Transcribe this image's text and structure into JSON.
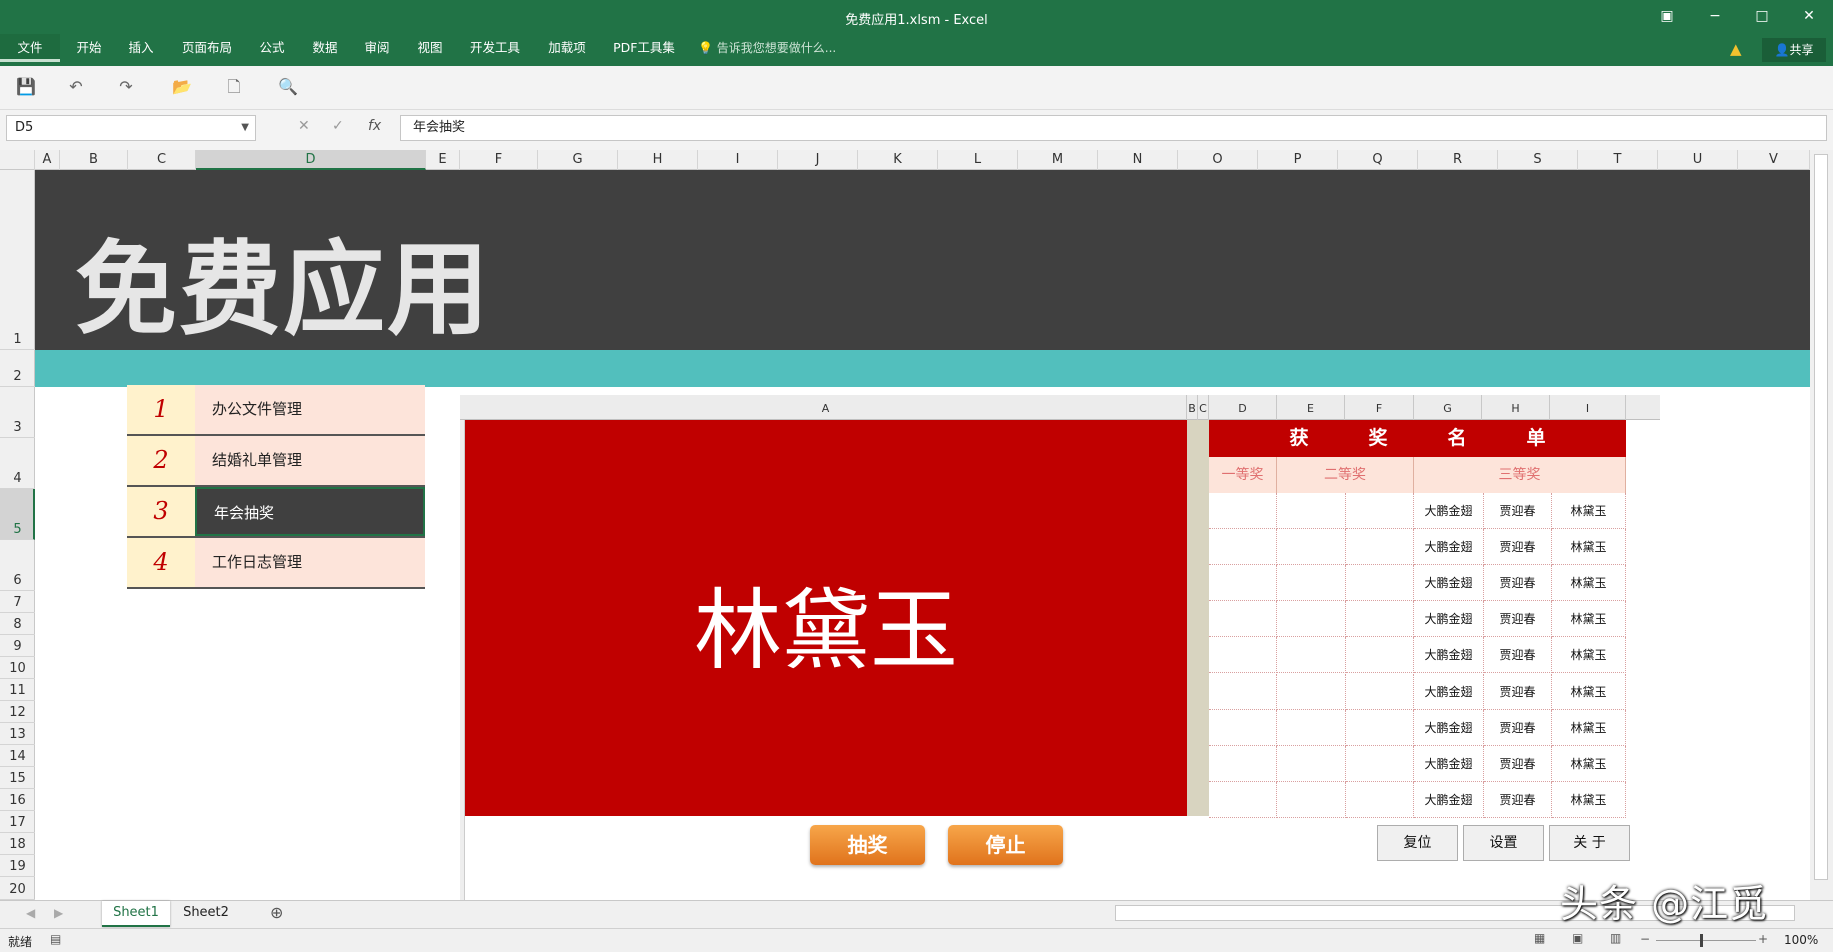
{
  "window": {
    "title": "免费应用1.xlsm - Excel",
    "share": "共享"
  },
  "menu": {
    "items": [
      "文件",
      "开始",
      "插入",
      "页面布局",
      "公式",
      "数据",
      "审阅",
      "视图",
      "开发工具",
      "加载项",
      "PDF工具集"
    ],
    "tellme": "告诉我您想要做什么..."
  },
  "formula_bar": {
    "name_box": "D5",
    "fx": "fx",
    "content": "年会抽奖"
  },
  "columns": [
    "A",
    "B",
    "C",
    "D",
    "E",
    "F",
    "G",
    "H",
    "I",
    "J",
    "K",
    "L",
    "M",
    "N",
    "O",
    "P",
    "Q",
    "R",
    "S",
    "T",
    "U",
    "V"
  ],
  "rows": [
    "1",
    "2",
    "3",
    "4",
    "5",
    "6",
    "7",
    "8",
    "9",
    "10",
    "11",
    "12",
    "13",
    "14",
    "15",
    "16",
    "17",
    "18",
    "19",
    "20"
  ],
  "banner": {
    "title": "免费应用"
  },
  "nav": [
    {
      "num": "1",
      "label": "办公文件管理"
    },
    {
      "num": "2",
      "label": "结婚礼单管理"
    },
    {
      "num": "3",
      "label": "年会抽奖"
    },
    {
      "num": "4",
      "label": "工作日志管理"
    }
  ],
  "lottery": {
    "columns": [
      "A",
      "B",
      "C",
      "D",
      "E",
      "F",
      "G",
      "H",
      "I"
    ],
    "winner": "林黛玉",
    "board_title": "获奖名单",
    "prize_headers": [
      "一等奖",
      "二等奖",
      "三等奖"
    ],
    "third_prize_names": [
      "大鹏金翅",
      "贾迎春",
      "林黛玉"
    ],
    "rows": 9,
    "buttons": {
      "draw": "抽奖",
      "stop": "停止",
      "reset": "复位",
      "settings": "设置",
      "about": "关 于"
    }
  },
  "sheets": [
    "Sheet1",
    "Sheet2"
  ],
  "status": {
    "ready": "就绪",
    "zoom": "100%"
  },
  "watermark": "头条 @江觅"
}
